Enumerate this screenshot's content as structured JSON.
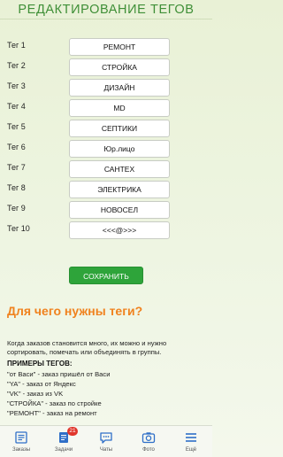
{
  "page": {
    "title": "РЕДАКТИРОВАНИЕ ТЕГОВ"
  },
  "tags": [
    {
      "label": "Тег 1",
      "value": "РЕМОНТ"
    },
    {
      "label": "Тег 2",
      "value": "СТРОЙКА"
    },
    {
      "label": "Тег 3",
      "value": "ДИЗАЙН"
    },
    {
      "label": "Тег 4",
      "value": "MD"
    },
    {
      "label": "Тег 5",
      "value": "СЕПТИКИ"
    },
    {
      "label": "Тег 6",
      "value": "Юр.лицо"
    },
    {
      "label": "Тег 7",
      "value": "САНТЕХ"
    },
    {
      "label": "Тег 8",
      "value": "ЭЛЕКТРИКА"
    },
    {
      "label": "Тег 9",
      "value": "НОВОСЕЛ"
    },
    {
      "label": "Тег 10",
      "value": "<<<@>>>"
    }
  ],
  "save_button": {
    "label": "СОХРАНИТЬ"
  },
  "info": {
    "heading": "Для чего нужны теги?",
    "text": "Когда заказов становится много, их можно и нужно сортировать, помечать или объединять в группы.",
    "examples_title": "ПРИМЕРЫ ТЕГОВ:",
    "examples": [
      "\"от Васи\" - заказ пришёл от Васи",
      "\"YA\" - заказ от Яндекс",
      "\"VK\" - заказ из VK",
      "\"СТРОЙКА\" - заказ по стройке",
      "\"РЕМОНТ\" - заказ на ремонт"
    ]
  },
  "tabbar": {
    "accent_color": "#2f6fc8",
    "items": [
      {
        "label": "Заказы",
        "icon": "orders-icon"
      },
      {
        "label": "Задачи",
        "icon": "tasks-icon",
        "badge": "21"
      },
      {
        "label": "Чаты",
        "icon": "chat-icon"
      },
      {
        "label": "Фото",
        "icon": "camera-icon"
      },
      {
        "label": "Ещё",
        "icon": "menu-icon"
      }
    ]
  }
}
